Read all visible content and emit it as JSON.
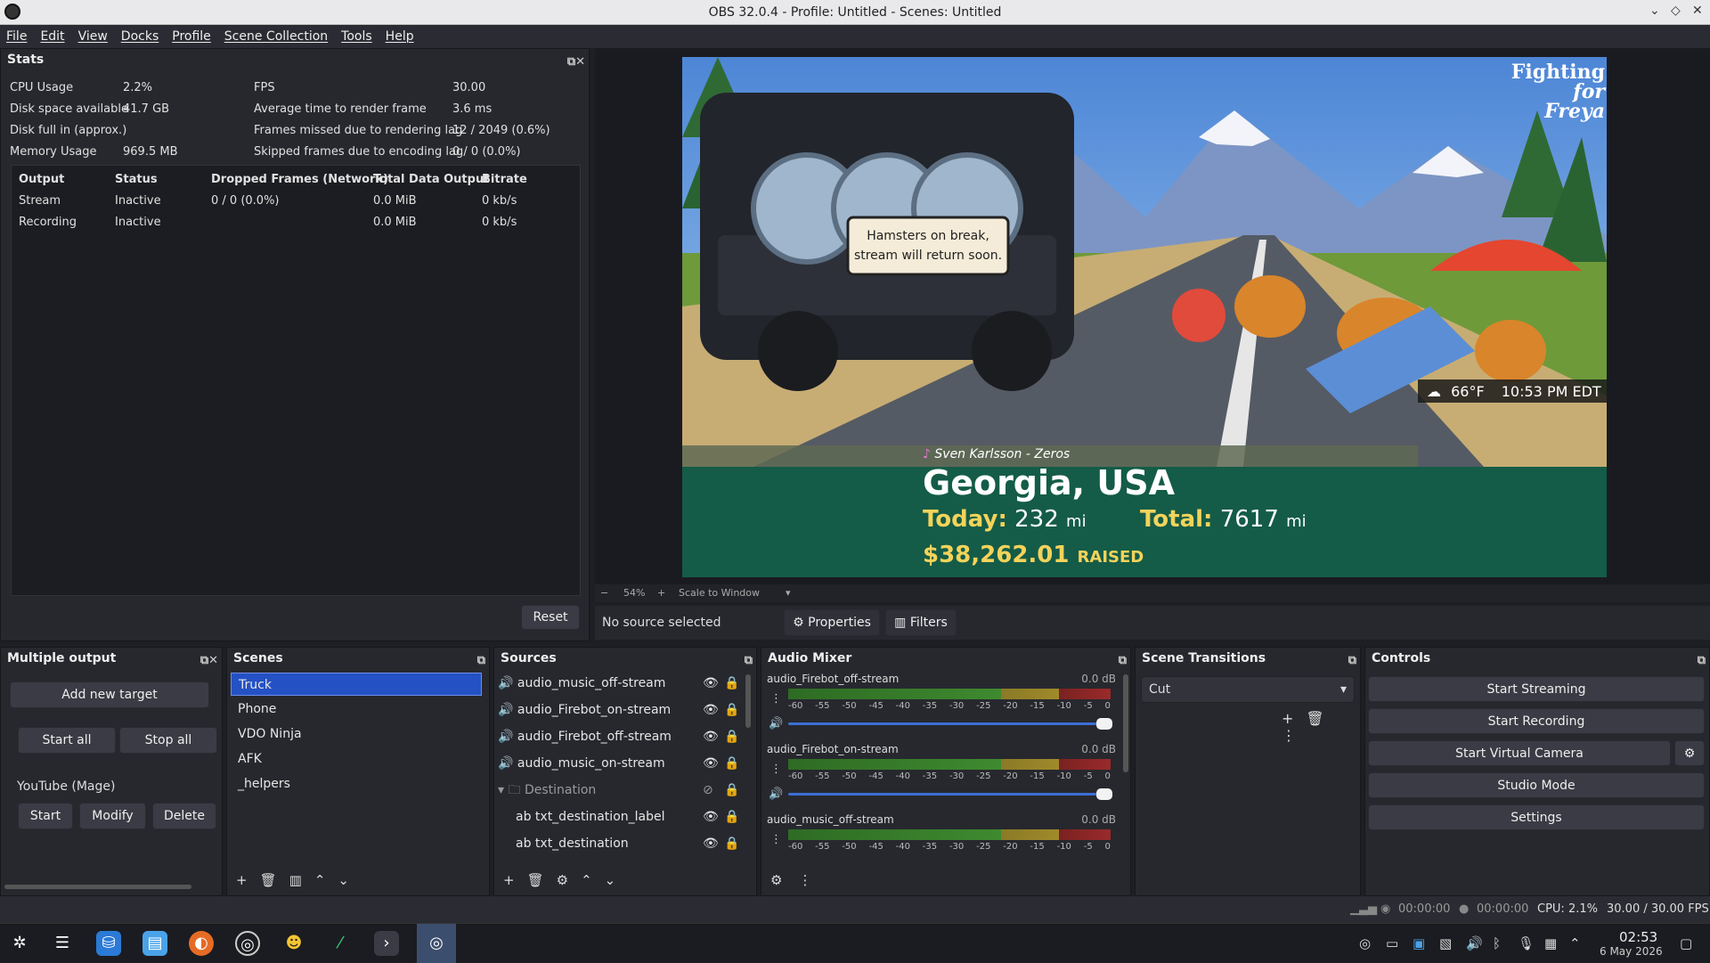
{
  "window": {
    "title": "OBS 32.0.4 - Profile: Untitled - Scenes: Untitled"
  },
  "menu": [
    "File",
    "Edit",
    "View",
    "Docks",
    "Profile",
    "Scene Collection",
    "Tools",
    "Help"
  ],
  "stats": {
    "title": "Stats",
    "rows_left": [
      [
        "CPU Usage",
        "2.2%"
      ],
      [
        "Disk space available",
        "41.7 GB"
      ],
      [
        "Disk full in (approx.)",
        ""
      ],
      [
        "Memory Usage",
        "969.5 MB"
      ]
    ],
    "rows_right": [
      [
        "FPS",
        "30.00"
      ],
      [
        "Average time to render frame",
        "3.6 ms"
      ],
      [
        "Frames missed due to rendering lag",
        "12 / 2049 (0.6%)"
      ],
      [
        "Skipped frames due to encoding lag",
        "0 / 0 (0.0%)"
      ]
    ],
    "table_headers": [
      "Output",
      "Status",
      "Dropped Frames (Network)",
      "Total Data Output",
      "Bitrate"
    ],
    "table_rows": [
      [
        "Stream",
        "Inactive",
        "0 / 0 (0.0%)",
        "0.0 MiB",
        "0 kb/s"
      ],
      [
        "Recording",
        "Inactive",
        "",
        "0.0 MiB",
        "0 kb/s"
      ]
    ],
    "reset": "Reset"
  },
  "preview": {
    "logo_line1": "Fighting",
    "logo_line2": "for Freya",
    "sign_line1": "Hamsters on break,",
    "sign_line2": "stream will return soon.",
    "weather_temp": "66°F",
    "weather_time": "10:53 PM EDT",
    "song": "Sven Karlsson - Zeros",
    "location": "Georgia, USA",
    "today_label": "Today:",
    "today_value": "232",
    "today_unit": "mi",
    "total_label": "Total:",
    "total_value": "7617",
    "total_unit": "mi",
    "raised_amount": "$38,262.01",
    "raised_label": "RAISED"
  },
  "preview_toolbar": {
    "minus": "−",
    "zoom": "54%",
    "plus": "+",
    "scale_mode": "Scale to Window"
  },
  "context": {
    "no_source": "No source selected",
    "properties": "Properties",
    "filters": "Filters"
  },
  "multi_output": {
    "title": "Multiple output",
    "add_target": "Add new target",
    "start_all": "Start all",
    "stop_all": "Stop all",
    "target_name": "YouTube (Mage)",
    "start": "Start",
    "modify": "Modify",
    "delete": "Delete"
  },
  "scenes": {
    "title": "Scenes",
    "items": [
      "Truck",
      "Phone",
      "VDO Ninja",
      "AFK",
      "_helpers"
    ]
  },
  "sources": {
    "title": "Sources",
    "items": [
      {
        "label": "audio_music_off-stream",
        "type": "audio"
      },
      {
        "label": "audio_Firebot_on-stream",
        "type": "audio"
      },
      {
        "label": "audio_Firebot_off-stream",
        "type": "audio"
      },
      {
        "label": "audio_music_on-stream",
        "type": "audio"
      },
      {
        "label": "Destination",
        "type": "group"
      },
      {
        "label": "txt_destination_label",
        "type": "text"
      },
      {
        "label": "txt_destination",
        "type": "text"
      }
    ]
  },
  "mixer": {
    "title": "Audio Mixer",
    "channels": [
      {
        "name": "audio_Firebot_off-stream",
        "db": "0.0 dB"
      },
      {
        "name": "audio_Firebot_on-stream",
        "db": "0.0 dB"
      },
      {
        "name": "audio_music_off-stream",
        "db": "0.0 dB"
      }
    ],
    "scale": [
      "-60",
      "-55",
      "-50",
      "-45",
      "-40",
      "-35",
      "-30",
      "-25",
      "-20",
      "-15",
      "-10",
      "-5",
      "0"
    ]
  },
  "transitions": {
    "title": "Scene Transitions",
    "selected": "Cut"
  },
  "controls": {
    "title": "Controls",
    "buttons": [
      "Start Streaming",
      "Start Recording",
      "Start Virtual Camera",
      "Studio Mode",
      "Settings"
    ]
  },
  "status": {
    "stream_time": "00:00:00",
    "rec_time": "00:00:00",
    "cpu": "CPU: 2.1%",
    "fps": "30.00 / 30.00 FPS"
  },
  "clock": {
    "time": "02:53",
    "date": "6 May 2026"
  }
}
